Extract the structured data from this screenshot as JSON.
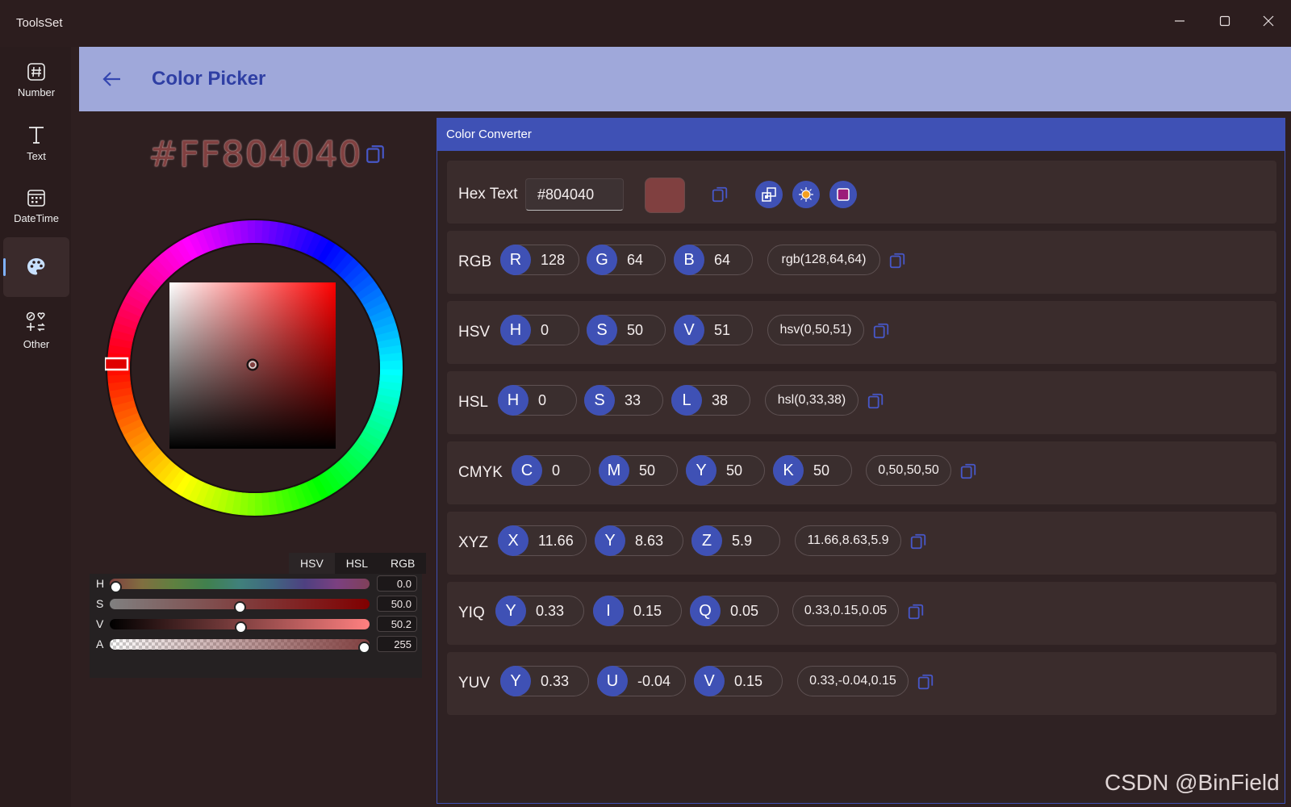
{
  "window": {
    "title": "ToolsSet"
  },
  "nav": {
    "items": [
      {
        "label": "Number",
        "icon": "hash-icon"
      },
      {
        "label": "Text",
        "icon": "text-icon"
      },
      {
        "label": "DateTime",
        "icon": "calendar-icon"
      },
      {
        "label": "",
        "icon": "palette-icon",
        "selected": true
      },
      {
        "label": "Other",
        "icon": "other-tools-icon"
      }
    ]
  },
  "header": {
    "title": "Color Picker"
  },
  "picker": {
    "hex": "#FF804040",
    "color": "#804040",
    "tabs": [
      "HSV",
      "HSL",
      "RGB"
    ],
    "active_tab": "HSV",
    "sliders": [
      {
        "label": "H",
        "value": "0.0",
        "level": 0.0
      },
      {
        "label": "S",
        "value": "50.0",
        "level": 0.5
      },
      {
        "label": "V",
        "value": "50.2",
        "level": 0.502
      },
      {
        "label": "A",
        "value": "255",
        "level": 1.0
      }
    ]
  },
  "converter": {
    "title": "Color Converter",
    "hex": {
      "label": "Hex Text",
      "value": "#804040",
      "swatch": "#804040"
    },
    "rows": [
      {
        "label": "RGB",
        "fields": [
          {
            "k": "R",
            "v": "128"
          },
          {
            "k": "G",
            "v": "64"
          },
          {
            "k": "B",
            "v": "64"
          }
        ],
        "summary": "rgb(128,64,64)"
      },
      {
        "label": "HSV",
        "fields": [
          {
            "k": "H",
            "v": "0"
          },
          {
            "k": "S",
            "v": "50"
          },
          {
            "k": "V",
            "v": "51"
          }
        ],
        "summary": "hsv(0,50,51)"
      },
      {
        "label": "HSL",
        "fields": [
          {
            "k": "H",
            "v": "0"
          },
          {
            "k": "S",
            "v": "33"
          },
          {
            "k": "L",
            "v": "38"
          }
        ],
        "summary": "hsl(0,33,38)"
      },
      {
        "label": "CMYK",
        "fields": [
          {
            "k": "C",
            "v": "0"
          },
          {
            "k": "M",
            "v": "50"
          },
          {
            "k": "Y",
            "v": "50"
          },
          {
            "k": "K",
            "v": "50"
          }
        ],
        "summary": "0,50,50,50"
      },
      {
        "label": "XYZ",
        "fields": [
          {
            "k": "X",
            "v": "11.66"
          },
          {
            "k": "Y",
            "v": "8.63"
          },
          {
            "k": "Z",
            "v": "5.9"
          }
        ],
        "summary": "11.66,8.63,5.9"
      },
      {
        "label": "YIQ",
        "fields": [
          {
            "k": "Y",
            "v": "0.33"
          },
          {
            "k": "I",
            "v": "0.15"
          },
          {
            "k": "Q",
            "v": "0.05"
          }
        ],
        "summary": "0.33,0.15,0.05"
      },
      {
        "label": "YUV",
        "fields": [
          {
            "k": "Y",
            "v": "0.33"
          },
          {
            "k": "U",
            "v": "-0.04"
          },
          {
            "k": "V",
            "v": "0.15"
          }
        ],
        "summary": "0.33,-0.04,0.15"
      }
    ]
  },
  "watermark": "CSDN @BinField",
  "colors": {
    "accent": "#3f51b5",
    "header_bg": "#9fa8da",
    "title_blue": "#2f3fa4"
  }
}
